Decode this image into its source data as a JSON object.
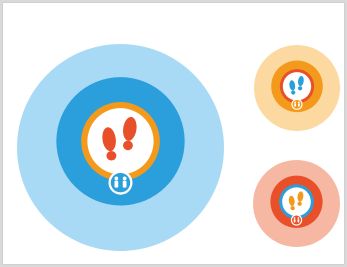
{
  "badges": [
    {
      "variant": "large-blue",
      "colors": {
        "halo": "#a9daf5",
        "ring": "#2a9fdc",
        "accent": "#f39a1d",
        "inner": "#ffffff",
        "footprints": "#e8502a",
        "people_badge": "#2a9fdc"
      },
      "icon": "footprints-icon",
      "sub_icon": "two-people-icon"
    },
    {
      "variant": "small-orange",
      "colors": {
        "halo": "#fcd9a0",
        "ring": "#f39a1d",
        "accent": "#e8502a",
        "inner": "#ffffff",
        "footprints": "#2a9fdc",
        "people_badge": "#f39a1d"
      },
      "icon": "footprints-icon",
      "sub_icon": "two-people-icon"
    },
    {
      "variant": "small-red",
      "colors": {
        "halo": "#f6b8a3",
        "ring": "#e8502a",
        "accent": "#2a9fdc",
        "inner": "#ffffff",
        "footprints": "#f39a1d",
        "people_badge": "#e8502a"
      },
      "icon": "footprints-icon",
      "sub_icon": "two-people-icon"
    }
  ]
}
